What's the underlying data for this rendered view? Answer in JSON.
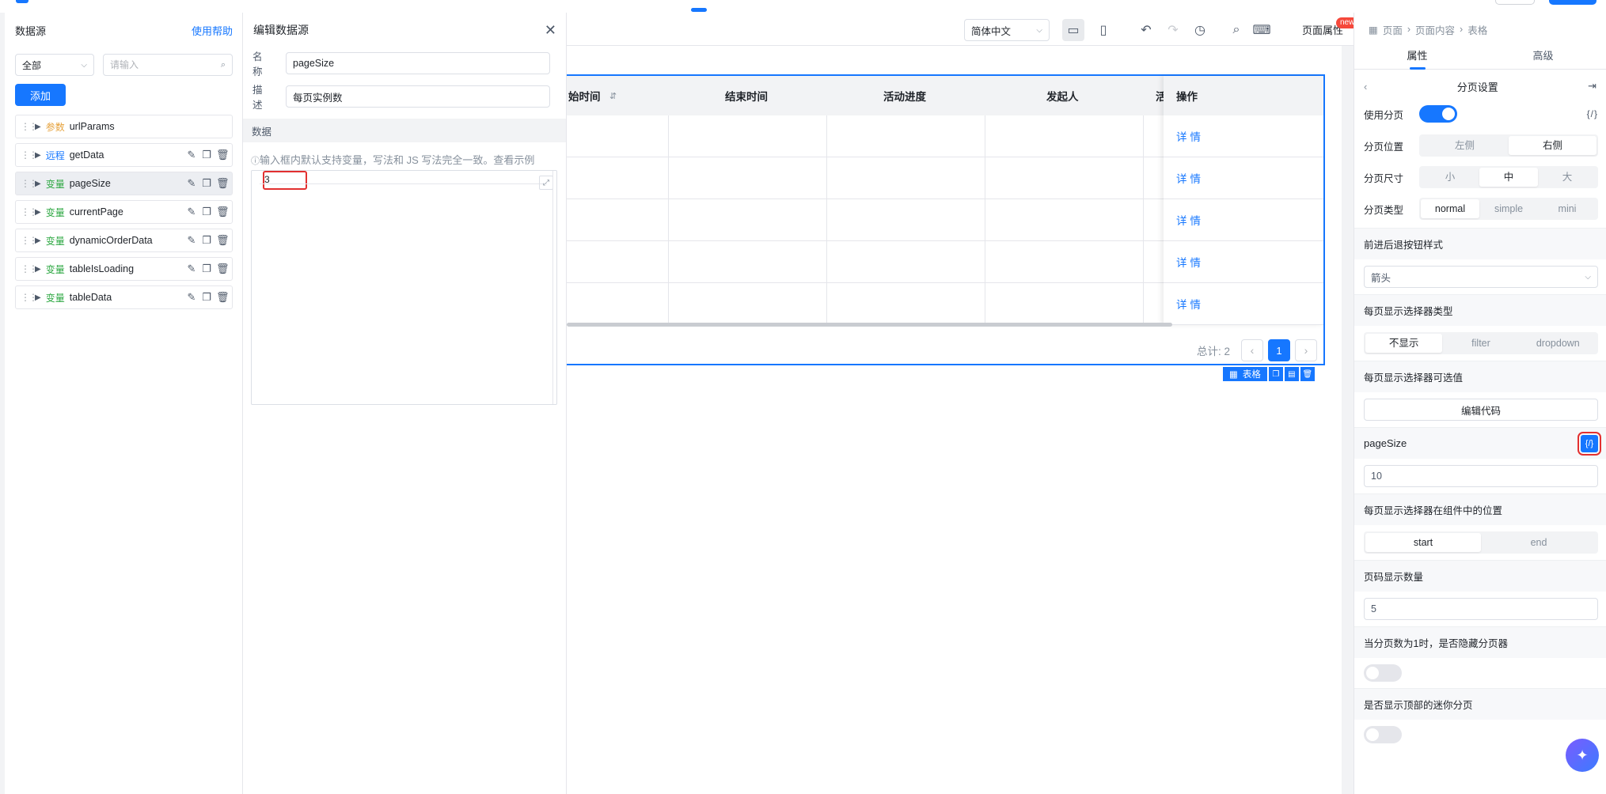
{
  "datasource_panel": {
    "title": "数据源",
    "help": "使用帮助",
    "filter_value": "全部",
    "search_placeholder": "请输入",
    "add_label": "添加",
    "items": [
      {
        "tag": "参数",
        "tag_type": "param",
        "name": "urlParams"
      },
      {
        "tag": "远程",
        "tag_type": "remote",
        "name": "getData"
      },
      {
        "tag": "变量",
        "tag_type": "var",
        "name": "pageSize"
      },
      {
        "tag": "变量",
        "tag_type": "var",
        "name": "currentPage"
      },
      {
        "tag": "变量",
        "tag_type": "var",
        "name": "dynamicOrderData"
      },
      {
        "tag": "变量",
        "tag_type": "var",
        "name": "tableIsLoading"
      },
      {
        "tag": "变量",
        "tag_type": "var",
        "name": "tableData"
      }
    ]
  },
  "edit_panel": {
    "title": "编辑数据源",
    "name_label": "名称",
    "name_value": "pageSize",
    "desc_label": "描述",
    "desc_value": "每页实例数",
    "data_label": "数据",
    "hint": "输入框内默认支持变量，写法和 JS 写法完全一致。查看示例",
    "code_value": "3"
  },
  "toolbar": {
    "language": "简体中文",
    "page_props": "页面属性",
    "new_badge": "new"
  },
  "table": {
    "columns": [
      "始时间",
      "结束时间",
      "活动进度",
      "发起人",
      "活"
    ],
    "op_header": "操作",
    "op_cells": [
      "详情",
      "详情",
      "详情",
      "详情",
      "详情"
    ],
    "total": "总计: 2",
    "current_page": "1",
    "badge_label": "表格"
  },
  "props_panel": {
    "breadcrumb": [
      "页面",
      "页面内容",
      "表格"
    ],
    "tabs": [
      "属性",
      "高级"
    ],
    "section_title": "分页设置",
    "use_paging_label": "使用分页",
    "code_tag": "{/}",
    "position_label": "分页位置",
    "position_options": [
      "左侧",
      "右侧"
    ],
    "size_label": "分页尺寸",
    "size_options": [
      "小",
      "中",
      "大"
    ],
    "type_label": "分页类型",
    "type_options": [
      "normal",
      "simple",
      "mini"
    ],
    "nav_style_title": "前进后退按钮样式",
    "nav_style_value": "箭头",
    "selector_type_title": "每页显示选择器类型",
    "selector_type_options": [
      "不显示",
      "filter",
      "dropdown"
    ],
    "selector_options_title": "每页显示选择器可选值",
    "edit_code": "编辑代码",
    "pagesize_title": "pageSize",
    "pagesize_value": "10",
    "selector_position_title": "每页显示选择器在组件中的位置",
    "selector_position_options": [
      "start",
      "end"
    ],
    "page_count_title": "页码显示数量",
    "page_count_value": "5",
    "hide_single_title": "当分页数为1时，是否隐藏分页器",
    "mini_top_title": "是否显示顶部的迷你分页"
  }
}
